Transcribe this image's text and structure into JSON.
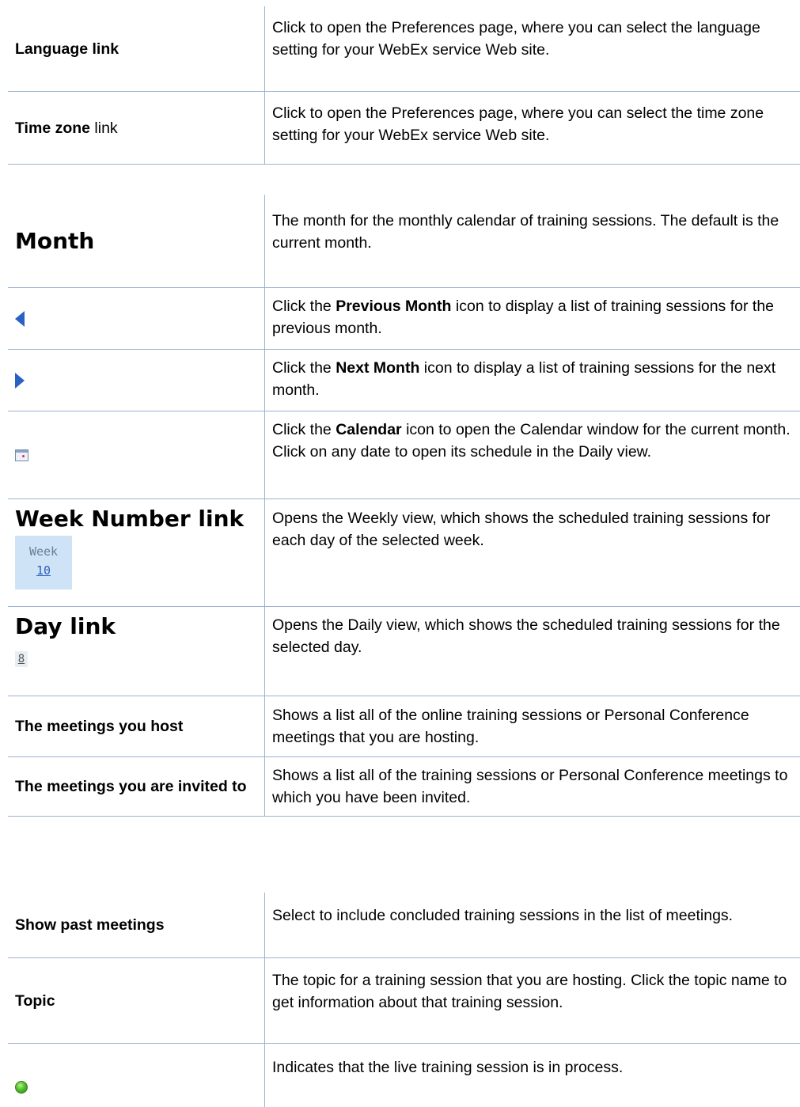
{
  "table1": {
    "rows": [
      {
        "label": "Language link",
        "desc": "Click to open the Preferences page, where you can select the language setting for your WebEx service Web site."
      },
      {
        "label_bold": "Time zone",
        "label_rest": " link",
        "desc": "Click to open the Preferences page, where you can select the time zone setting for your WebEx service Web site."
      }
    ]
  },
  "table2": {
    "month": {
      "label": "Month",
      "desc": "The month for the monthly calendar of training sessions. The default is the current month."
    },
    "prev": {
      "icon": "previous-month-icon",
      "desc_pre": "Click the ",
      "desc_bold": "Previous Month",
      "desc_post": " icon to display a list of training sessions for the previous month."
    },
    "next": {
      "icon": "next-month-icon",
      "desc_pre": "Click the ",
      "desc_bold": "Next Month",
      "desc_post": " icon to display a list of training sessions for the next month."
    },
    "calendar": {
      "icon": "calendar-icon",
      "desc_pre": "Click the ",
      "desc_bold": "Calendar",
      "desc_post": " icon to open the Calendar window for the current month. Click on any date to open its schedule in the Daily view."
    },
    "week": {
      "label": "Week Number link",
      "box_title": "Week",
      "box_number": "10",
      "desc": "Opens the Weekly view, which shows the scheduled training sessions for each day of the selected week."
    },
    "day": {
      "label": "Day link",
      "box_number": "8",
      "desc": "Opens the Daily view, which shows the scheduled training sessions for the selected day."
    },
    "host": {
      "label": "The meetings you host",
      "desc": "Shows a list all of the online training sessions or Personal Conference meetings that you are hosting."
    },
    "invited": {
      "label": "The meetings you are invited to",
      "desc": "Shows a list all of the training sessions or Personal Conference meetings to which you have been invited."
    }
  },
  "table3": {
    "past": {
      "label": "Show past meetings",
      "desc": "Select to include concluded training sessions in the list of meetings."
    },
    "topic": {
      "label": "Topic",
      "desc": "The topic for a training session that you are hosting. Click the topic name to get information about that training session."
    },
    "live": {
      "icon": "live-session-icon",
      "desc": "Indicates that the live training session is in process."
    }
  },
  "colors": {
    "rule": "#9ab3d0",
    "arrow": "#2a62c4",
    "week_bg": "#cfe3f7"
  }
}
